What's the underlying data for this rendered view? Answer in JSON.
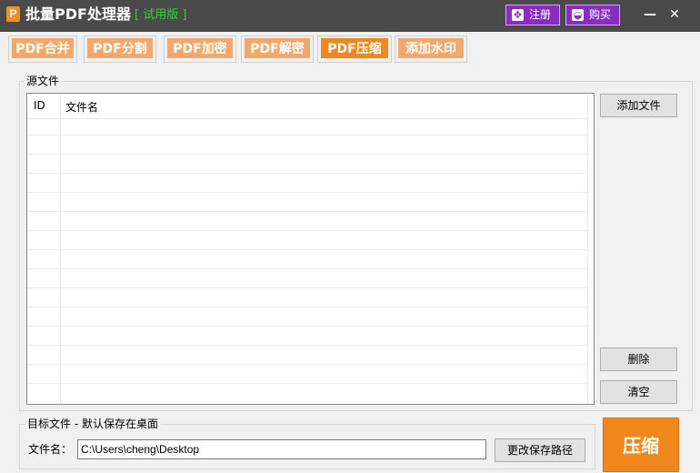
{
  "app": {
    "logo_letter": "P",
    "title": "批量PDF处理器",
    "edition": "[ 试用版 ]",
    "register_label": "注册",
    "buy_label": "购买",
    "minimize_glyph": "—",
    "close_glyph": "✕",
    "colors": {
      "titlebar": "#4a4a4a",
      "accent_purple": "#8a2bc2",
      "tab_orange": "#f2a86a",
      "tab_active_orange": "#f0871a",
      "edition_green": "#31d32e"
    }
  },
  "tabs": [
    {
      "label": "PDF合并",
      "active": false
    },
    {
      "label": "PDF分割",
      "active": false
    },
    {
      "label": "PDF加密",
      "active": false
    },
    {
      "label": "PDF解密",
      "active": false
    },
    {
      "label": "PDF压缩",
      "active": true
    },
    {
      "label": "添加水印",
      "active": false
    }
  ],
  "source": {
    "group_title": "源文件",
    "columns": {
      "id": "ID",
      "name": "文件名"
    },
    "add_button": "添加文件",
    "delete_button": "删除",
    "clear_button": "清空"
  },
  "target": {
    "group_title": "目标文件 - 默认保存在桌面",
    "filename_label": "文件名：",
    "path_value": "C:\\Users\\cheng\\Desktop",
    "change_path_button": "更改保存路径"
  },
  "action": {
    "compress_button": "压缩"
  }
}
